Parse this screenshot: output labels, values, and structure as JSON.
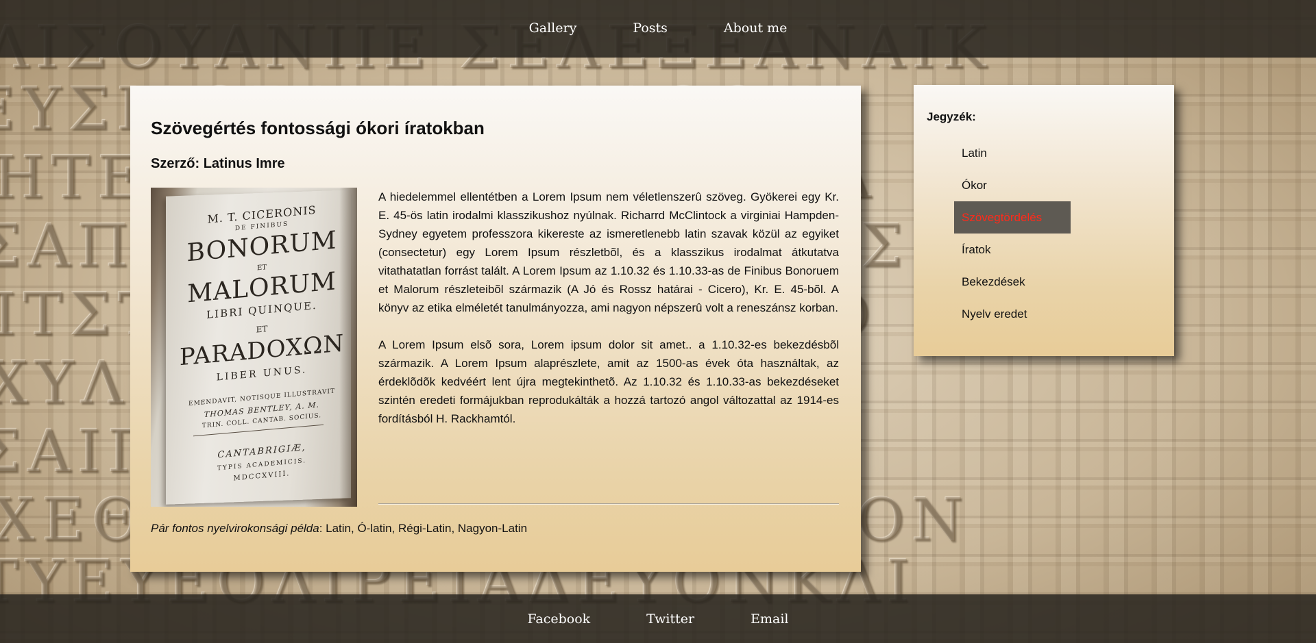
{
  "top_nav": {
    "items": [
      {
        "label": "Gallery"
      },
      {
        "label": "Posts"
      },
      {
        "label": "About me"
      }
    ]
  },
  "article": {
    "title": "Szövegértés fontossági ókori íratokban",
    "author_label": "Szerző:",
    "author_name": "Latinus Imre",
    "image": {
      "lines": [
        "M. T. CICERONIS",
        "DE FINIBUS",
        "BONORUM",
        "ET",
        "MALORUM",
        "LIBRI QUINQUE.",
        "ET",
        "PARADOXΩN",
        "LIBER UNUS.",
        "EMENDAVIT, NOTISQUE ILLUSTRAVIT",
        "THOMAS BENTLEY, A. M.",
        "TRIN. COLL. CANTAB. SOCIUS.",
        "CANTABRIGIÆ,",
        "TYPIS ACADEMICIS.",
        "MDCCXVIII."
      ]
    },
    "paragraphs": [
      "A hiedelemmel ellentétben a Lorem Ipsum nem véletlenszerû szöveg. Gyökerei egy Kr. E. 45-ös latin irodalmi klasszikushoz nyúlnak. Richarrd McClintock a virginiai Hampden-Sydney egyetem professzora kikereste az ismeretlenebb latin szavak közül az egyiket (consectetur) egy Lorem Ipsum részletbõl, és a klasszikus irodalmat átkutatva vitathatatlan forrást talált. A Lorem Ipsum az 1.10.32 és 1.10.33-as de Finibus Bonoruem et Malorum részleteibõl származik (A Jó és Rossz határai - Cicero), Kr. E. 45-bõl. A könyv az etika elméletét tanulmányozza, ami nagyon népszerû volt a reneszánsz korban.",
      "A Lorem Ipsum elsõ sora, Lorem ipsum dolor sit amet.. a 1.10.32-es bekezdésbõl származik. A Lorem Ipsum alaprészlete, amit az 1500-as évek óta használtak, az érdeklõdõk kedvéért lent újra megtekinthetõ. Az 1.10.32 és 1.10.33-as bekezdéseket szintén eredeti formájukban reprodukálták a hozzá tartozó angol változattal az 1914-es fordításból H. Rackhamtól."
    ],
    "footnote_label": "Pár fontos nyelvirokonsági példa",
    "footnote_value": ": Latin, Ó-latin, Régi-Latin, Nagyon-Latin"
  },
  "sidebar": {
    "title": "Jegyzék:",
    "items": [
      {
        "label": "Latin",
        "active": false
      },
      {
        "label": "Ókor",
        "active": false
      },
      {
        "label": "Szövegtördelés",
        "active": true
      },
      {
        "label": "Íratok",
        "active": false
      },
      {
        "label": "Bekezdések",
        "active": false
      },
      {
        "label": "Nyelv eredet",
        "active": false
      }
    ],
    "active_color": "#ff2a1a",
    "active_background": "#5e5a53"
  },
  "bottom_nav": {
    "items": [
      {
        "label": "Facebook"
      },
      {
        "label": "Twitter"
      },
      {
        "label": "Email"
      }
    ]
  },
  "colors": {
    "nav_bar": "#28241e",
    "card_top": "#faf8f5",
    "card_bottom": "#e8cc98"
  }
}
